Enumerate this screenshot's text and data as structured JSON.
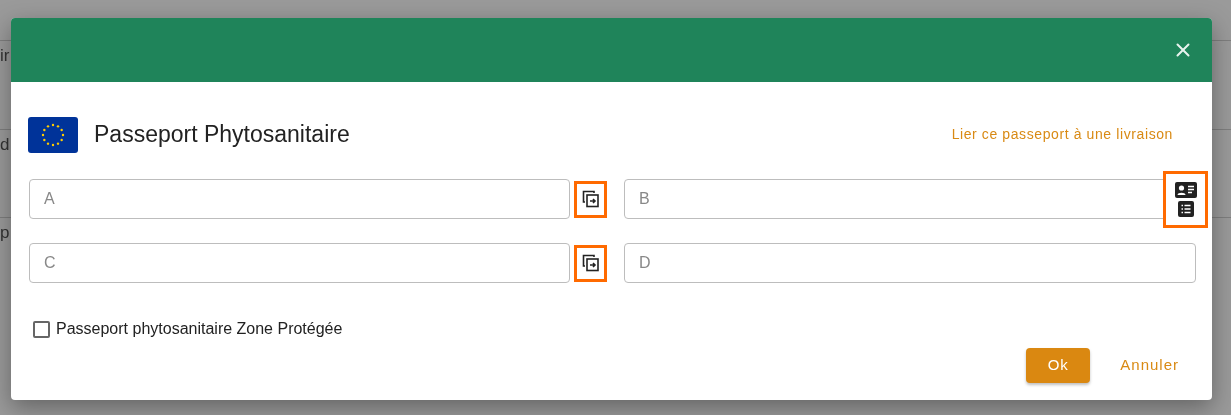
{
  "background": {
    "fragments": [
      "ir",
      "d",
      "p"
    ]
  },
  "dialog": {
    "title": "Passeport Phytosanitaire",
    "link": "Lier ce passeport à une livraison",
    "fields": [
      {
        "placeholder": "A",
        "action": {
          "kind": "copy",
          "highlighted": true
        }
      },
      {
        "placeholder": "B",
        "action": {
          "kind": "lookup",
          "highlighted": true
        }
      },
      {
        "placeholder": "C",
        "action": {
          "kind": "copy",
          "highlighted": true
        }
      },
      {
        "placeholder": "D"
      }
    ],
    "checkbox": {
      "label": "Passeport phytosanitaire Zone Protégée",
      "checked": false
    },
    "buttons": [
      {
        "label": "Ok",
        "kind": "primary"
      },
      {
        "label": "Annuler",
        "kind": "text"
      }
    ]
  }
}
